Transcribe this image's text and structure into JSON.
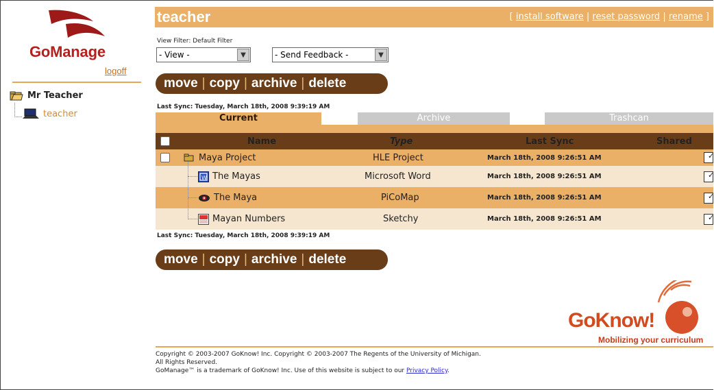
{
  "sidebar": {
    "brand": "GoManage",
    "logoff": "logoff",
    "tree_root": "Mr Teacher",
    "tree_child": "teacher"
  },
  "header": {
    "title": "teacher",
    "open_bracket": "[ ",
    "links": [
      "install software",
      "reset password",
      "rename"
    ],
    "separator": " | ",
    "close_bracket": " ]"
  },
  "filters": {
    "label": "View Filter: Default Filter",
    "view_select": "- View -",
    "feedback_select": "- Send Feedback -"
  },
  "actions": {
    "move": "move",
    "copy": "copy",
    "archive": "archive",
    "delete": "delete",
    "sep": "|"
  },
  "sync_text": "Last Sync: Tuesday, March 18th, 2008 9:39:19 AM",
  "tabs": {
    "current": "Current",
    "archive": "Archive",
    "trashcan": "Trashcan"
  },
  "table": {
    "headers": {
      "name": "Name",
      "type": "Type",
      "last_sync": "Last Sync",
      "shared": "Shared"
    },
    "rows": [
      {
        "name": "Maya Project",
        "type": "HLE Project",
        "last_sync": "March 18th, 2008 9:26:51 AM",
        "icon": "folder-icon"
      },
      {
        "name": "The Mayas",
        "type": "Microsoft Word",
        "last_sync": "March 18th, 2008 9:26:51 AM",
        "icon": "word-doc-icon"
      },
      {
        "name": "The Maya",
        "type": "PiCoMap",
        "last_sync": "March 18th, 2008 9:26:51 AM",
        "icon": "picomap-icon"
      },
      {
        "name": "Mayan Numbers",
        "type": "Sketchy",
        "last_sync": "March 18th, 2008 9:26:51 AM",
        "icon": "sketchy-icon"
      }
    ]
  },
  "brand_footer": {
    "logo": "GoKnow!",
    "tagline": "Mobilizing your curriculum"
  },
  "footer": {
    "line1": "Copyright © 2003-2007 GoKnow! Inc. Copyright © 2003-2007 The Regents of the University of Michigan.",
    "line2": "All Rights Reserved.",
    "line3": "GoManage™ is a trademark of GoKnow! Inc. Use of this website is subject to our",
    "privacy_link": "Privacy Policy",
    "end": "."
  },
  "colors": {
    "header": "#ebb067",
    "bar": "#6a3d19",
    "row_light": "#f6e6cf",
    "brand_red": "#b3201e"
  }
}
